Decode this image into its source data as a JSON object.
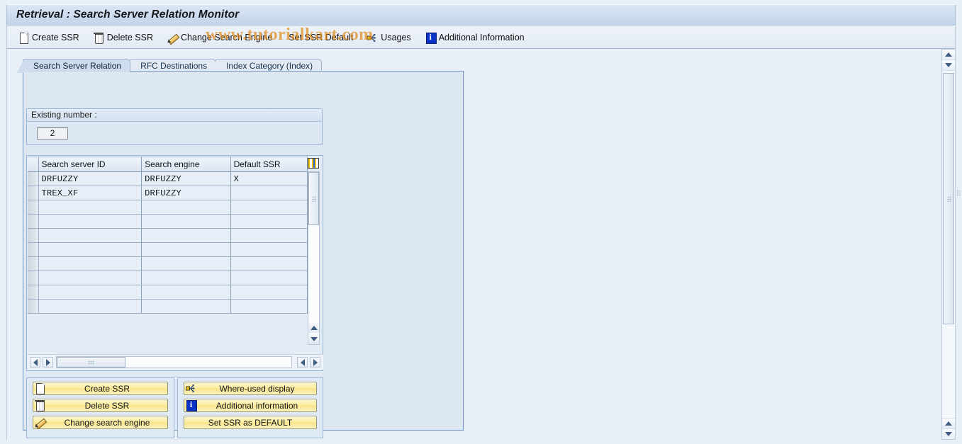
{
  "window": {
    "title": "Retrieval : Search Server Relation Monitor",
    "watermark": "www.tutorialkart.com"
  },
  "toolbar": {
    "buttons": [
      {
        "label": "Create SSR",
        "icon": "page-icon"
      },
      {
        "label": "Delete SSR",
        "icon": "trash-icon"
      },
      {
        "label": "Change Search Engine",
        "icon": "pencil-icon"
      },
      {
        "label": "Set SSR Default",
        "icon": "none"
      },
      {
        "label": "Usages",
        "icon": "usages-icon"
      },
      {
        "label": "Additional Information",
        "icon": "info-icon"
      }
    ]
  },
  "tabs": [
    {
      "label": "Search Server Relation",
      "active": true
    },
    {
      "label": "RFC Destinations",
      "active": false
    },
    {
      "label": "Index Category (Index)",
      "active": false
    }
  ],
  "existing": {
    "group_label": "Existing number :",
    "value": "2"
  },
  "table": {
    "columns": [
      "Search server ID",
      "Search engine",
      "Default SSR"
    ],
    "rows": [
      {
        "id": "DRFUZZY",
        "engine": "DRFUZZY",
        "default": "X"
      },
      {
        "id": "TREX_XF",
        "engine": "DRFUZZY",
        "default": ""
      },
      {
        "id": "",
        "engine": "",
        "default": ""
      },
      {
        "id": "",
        "engine": "",
        "default": ""
      },
      {
        "id": "",
        "engine": "",
        "default": ""
      },
      {
        "id": "",
        "engine": "",
        "default": ""
      },
      {
        "id": "",
        "engine": "",
        "default": ""
      },
      {
        "id": "",
        "engine": "",
        "default": ""
      },
      {
        "id": "",
        "engine": "",
        "default": ""
      },
      {
        "id": "",
        "engine": "",
        "default": ""
      }
    ]
  },
  "action_panel_left": {
    "buttons": [
      {
        "label": "Create SSR",
        "icon": "page-icon"
      },
      {
        "label": "Delete SSR",
        "icon": "trash-icon"
      },
      {
        "label": "Change search engine",
        "icon": "pencil-icon"
      }
    ]
  },
  "action_panel_right": {
    "buttons": [
      {
        "label": "Where-used display",
        "icon": "usages-icon"
      },
      {
        "label": "Additional information",
        "icon": "info-icon"
      },
      {
        "label": "Set SSR as DEFAULT",
        "icon": "none"
      }
    ]
  },
  "colors": {
    "title_bar": "#cddcef",
    "panel_bg": "#dee8f3",
    "button_yellow": "#fbeda0",
    "watermark": "#e28c1c",
    "accent_border": "#6e93c0"
  }
}
